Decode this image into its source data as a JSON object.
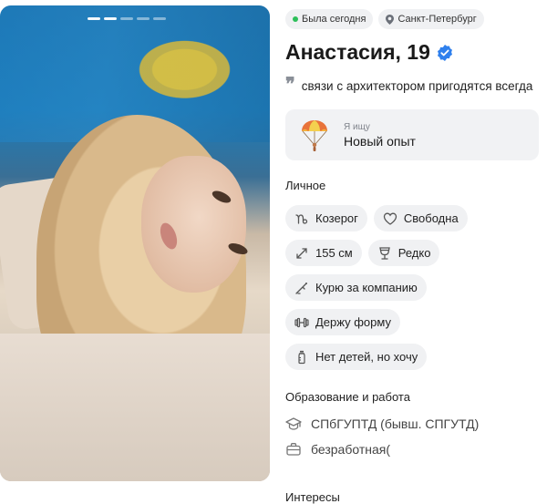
{
  "status": {
    "last_seen": "Была сегодня",
    "city": "Санкт-Петербург",
    "online_color": "#2dbf5a"
  },
  "profile": {
    "name": "Анастасия, 19",
    "verified_icon": "verified-check-icon",
    "quote": "связи с архитектором пригодятся всегда"
  },
  "seeking": {
    "label": "Я ищу",
    "value": "Новый опыт",
    "icon": "parachute-icon"
  },
  "personal": {
    "title": "Личное",
    "tags": [
      {
        "icon": "capricorn-icon",
        "label": "Козерог"
      },
      {
        "icon": "heart-icon",
        "label": "Свободна"
      },
      {
        "icon": "height-icon",
        "label": "155 см"
      },
      {
        "icon": "glass-icon",
        "label": "Редко"
      },
      {
        "icon": "cigarette-icon",
        "label": "Курю за компанию"
      },
      {
        "icon": "dumbbell-icon",
        "label": "Держу форму"
      },
      {
        "icon": "baby-bottle-icon",
        "label": "Нет детей, но хочу"
      }
    ]
  },
  "education": {
    "title": "Образование и работа",
    "school": "СПбГУПТД (бывш. СПГУТД)",
    "job": "безработная("
  },
  "interests": {
    "title": "Интересы"
  },
  "colors": {
    "accent": "#2f80ed",
    "chip_bg": "#f0f1f3"
  }
}
